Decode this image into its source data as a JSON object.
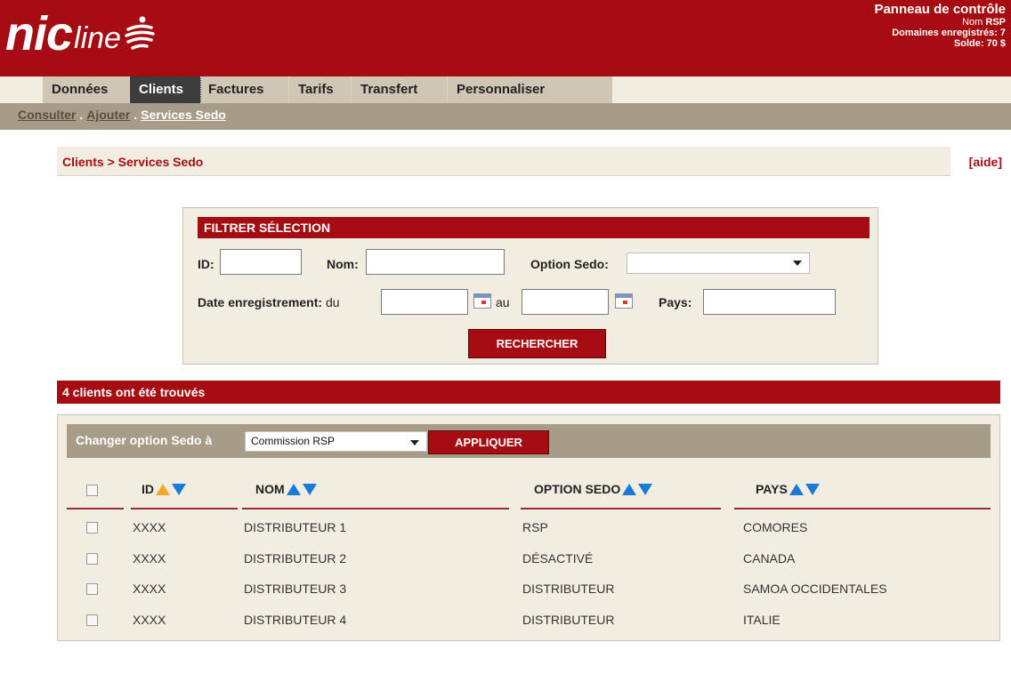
{
  "header": {
    "logo_nic": "nic",
    "logo_line": "line",
    "panel_title": "Panneau de contrôle",
    "nom_label": "Nom",
    "nom_value": "RSP",
    "domaines": "Domaines enregistrés: 7",
    "solde": "Solde: 70 $"
  },
  "mainnav": {
    "items": [
      "Données",
      "Clients",
      "Factures",
      "Tarifs",
      "Transfert",
      "Personnaliser"
    ],
    "active": "Clients"
  },
  "subnav": {
    "items": [
      "Consulter",
      "Ajouter",
      "Services Sedo"
    ],
    "separator": ".",
    "active": "Services Sedo"
  },
  "breadcrumb": "Clients > Services Sedo",
  "help_link": "[aide]",
  "filter": {
    "title": "FILTRER SÉLECTION",
    "id_label": "ID:",
    "nom_label": "Nom:",
    "option_label": "Option Sedo:",
    "option_value": "",
    "date_label": "Date enregistrement:",
    "du": "du",
    "au": "au",
    "pays_label": "Pays:",
    "search_button": "RECHERCHER"
  },
  "results_text": "4 clients ont été trouvés",
  "toolbar": {
    "label": "Changer option Sedo à",
    "selected": "Commission RSP",
    "apply_button": "APPLIQUER"
  },
  "table": {
    "columns": [
      "ID",
      "NOM",
      "OPTION SEDO",
      "PAYS"
    ],
    "rows": [
      {
        "id": "XXXX",
        "nom": "DISTRIBUTEUR 1",
        "option": "RSP",
        "pays": "COMORES"
      },
      {
        "id": "XXXX",
        "nom": "DISTRIBUTEUR 2",
        "option": "DÉSACTIVÉ",
        "pays": "CANADA"
      },
      {
        "id": "XXXX",
        "nom": "DISTRIBUTEUR 3",
        "option": "DISTRIBUTEUR",
        "pays": "SAMOA OCCIDENTALES"
      },
      {
        "id": "XXXX",
        "nom": "DISTRIBUTEUR 4",
        "option": "DISTRIBUTEUR",
        "pays": "ITALIE"
      }
    ]
  },
  "colors": {
    "brand_red": "#a60d12",
    "beige": "#f1ede1",
    "taupe": "#a79c88",
    "sort_blue": "#1a7bd6",
    "sort_active": "#f0a82a"
  }
}
